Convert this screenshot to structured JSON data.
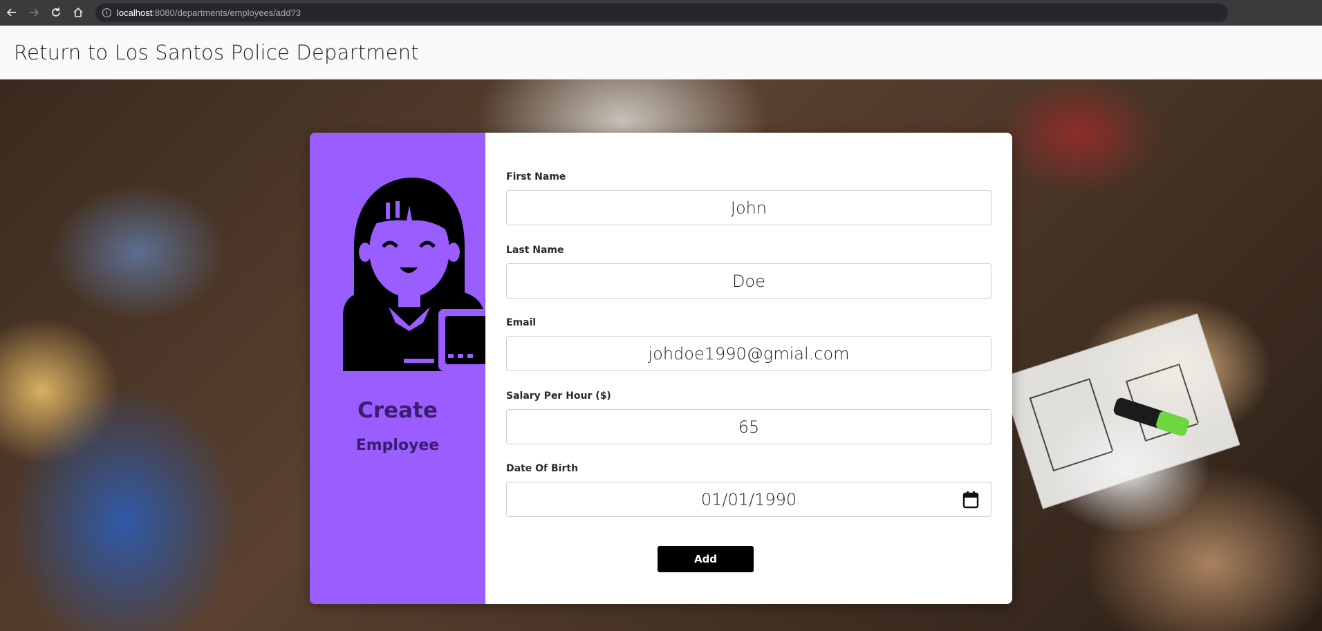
{
  "browser": {
    "url_host": "localhost",
    "url_path": ":8080/departments/employees/add?3",
    "back_icon": "arrow-left-icon",
    "forward_icon": "arrow-right-icon",
    "reload_icon": "reload-icon",
    "home_icon": "home-icon",
    "info_icon": "info-icon"
  },
  "topbar": {
    "return_link": "Return to Los Santos Police Department"
  },
  "sidebar": {
    "title": "Create",
    "subtitle": "Employee",
    "avatar_icon": "employee-avatar-icon",
    "accent": "#9a5dff",
    "text_color": "#3b1d6e"
  },
  "form": {
    "first_name": {
      "label": "First Name",
      "value": "John"
    },
    "last_name": {
      "label": "Last Name",
      "value": "Doe"
    },
    "email": {
      "label": "Email",
      "value": "johdoe1990@gmial.com"
    },
    "salary": {
      "label": "Salary Per Hour ($)",
      "value": "65"
    },
    "dob": {
      "label": "Date Of Birth",
      "value": "01/01/1990",
      "icon": "calendar-icon"
    },
    "submit_label": "Add"
  }
}
